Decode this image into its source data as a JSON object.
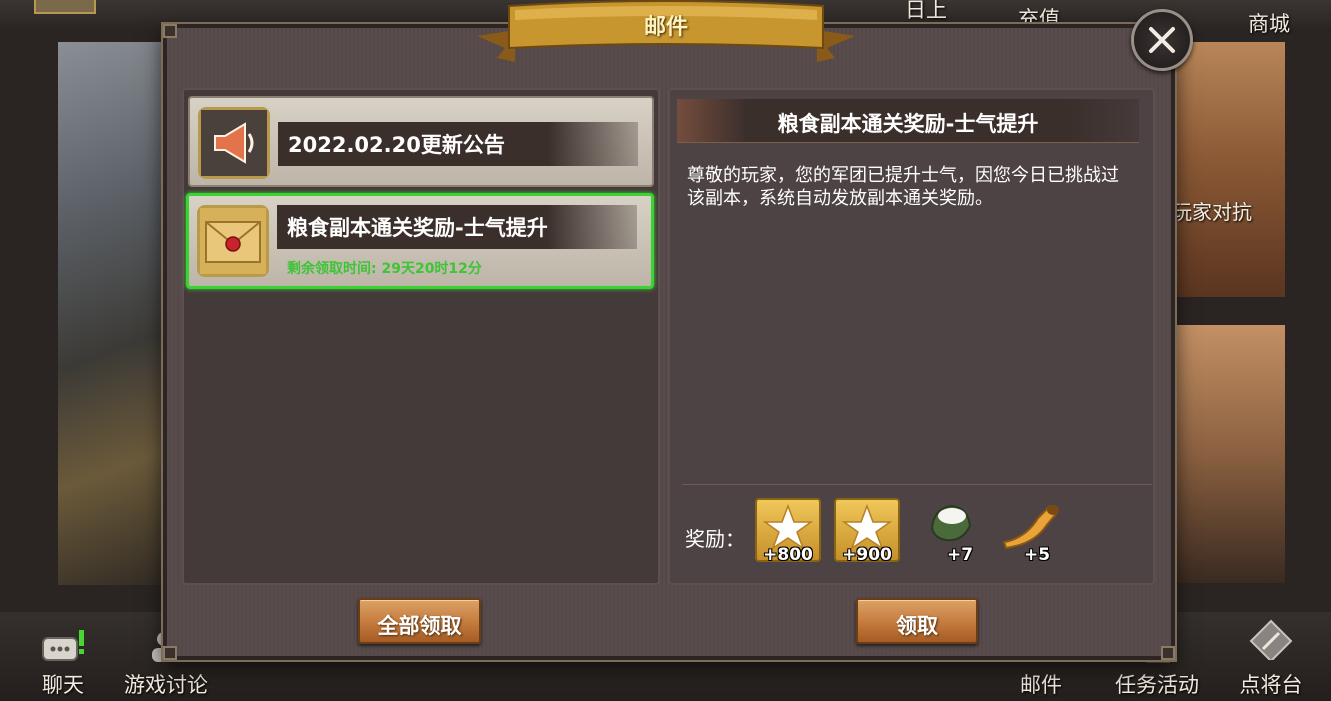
{
  "header": {
    "title": "邮件",
    "top_nav": [
      "日上",
      "充值",
      "商城"
    ]
  },
  "mail_list": [
    {
      "icon": "megaphone-icon",
      "title": "2022.02.20更新公告",
      "remaining": ""
    },
    {
      "icon": "sealed-envelope-icon",
      "title": "粮食副本通关奖励-士气提升",
      "remaining": "剩余领取时间: 29天20时12分",
      "selected": true
    }
  ],
  "detail": {
    "title": "粮食副本通关奖励-士气提升",
    "body": "尊敬的玩家，您的军团已提升士气，因您今日已挑战过该副本，系统自动发放副本通关奖励。",
    "reward_label": "奖励：",
    "rewards": [
      {
        "icon": "star-icon",
        "count": "+800"
      },
      {
        "icon": "star-icon",
        "count": "+900"
      },
      {
        "icon": "rice-bag-icon",
        "count": "+7"
      },
      {
        "icon": "horn-icon",
        "count": "+5"
      }
    ]
  },
  "buttons": {
    "claim_all": "全部领取",
    "claim": "领取"
  },
  "background": {
    "right_label": "玩家对抗"
  },
  "bottom_nav": [
    {
      "icon": "chat-icon",
      "label": "聊天"
    },
    {
      "icon": "discussion-icon",
      "label": "游戏讨论"
    },
    {
      "icon": "mail-icon",
      "label": "邮件"
    },
    {
      "icon": "task-icon",
      "label": "任务活动"
    },
    {
      "icon": "general-stage-icon",
      "label": "点将台"
    }
  ],
  "colors": {
    "selected_border": "#39d431",
    "remaining_text": "#3ec435",
    "button": "#c47a3c",
    "banner": "#c89a3c"
  }
}
